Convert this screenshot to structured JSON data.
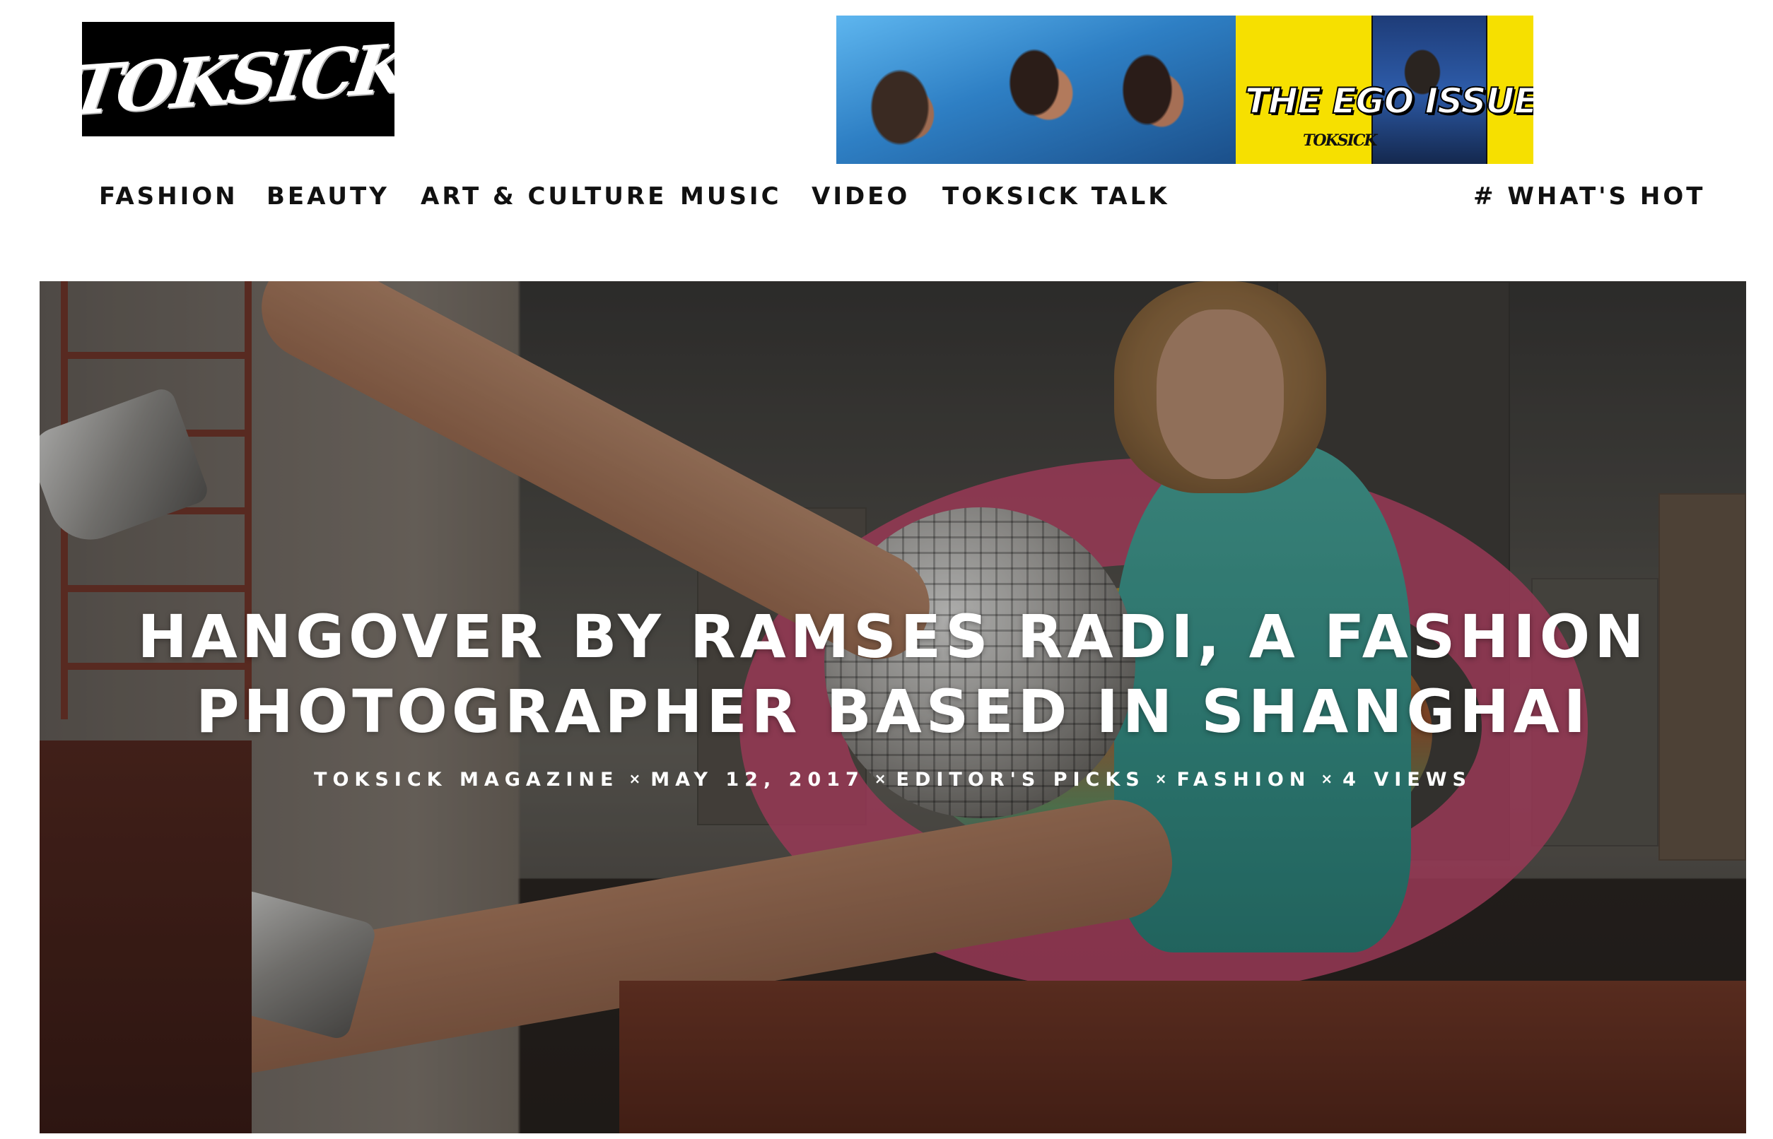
{
  "logo": {
    "text": "TOKSICK"
  },
  "ad": {
    "title": "THE EGO ISSUE",
    "brand": "TOKSICK"
  },
  "nav": {
    "items": [
      "FASHION",
      "BEAUTY",
      "ART & CULTURE",
      "MUSIC",
      "VIDEO",
      "TOKSICK TALK"
    ],
    "whats_hot": "# WHAT'S HOT"
  },
  "article": {
    "title_line1": "HANGOVER BY RAMSES RADI, A FASHION",
    "title_line2": "PHOTOGRAPHER BASED IN SHANGHAI",
    "author": "TOKSICK MAGAZINE",
    "date": "MAY 12, 2017",
    "category1": "EDITOR'S PICKS",
    "category2": "FASHION",
    "views": "4 VIEWS",
    "separator": "×"
  },
  "colors": {
    "ad_yellow": "#f6e000",
    "nav_text": "#111111",
    "hero_text": "#ffffff"
  }
}
